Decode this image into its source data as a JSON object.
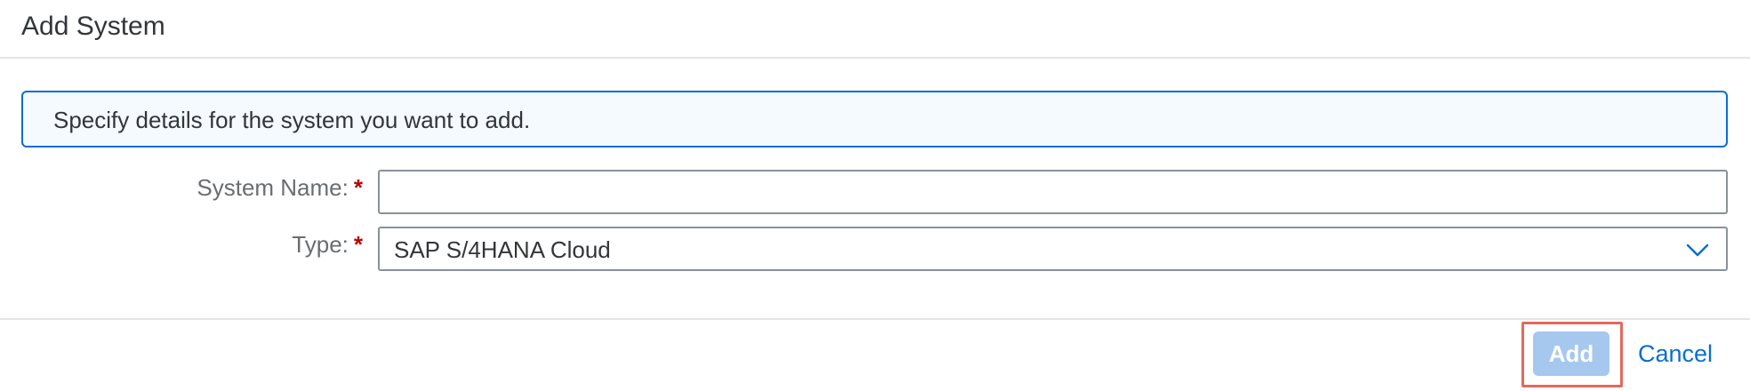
{
  "dialog": {
    "title": "Add System"
  },
  "info": {
    "text": "Specify details for the system you want to add."
  },
  "form": {
    "system_name": {
      "label": "System Name:",
      "required_marker": "*",
      "value": "",
      "placeholder": ""
    },
    "type": {
      "label": "Type:",
      "required_marker": "*",
      "value": "SAP S/4HANA Cloud"
    }
  },
  "footer": {
    "add_label": "Add",
    "cancel_label": "Cancel"
  },
  "icons": {
    "dropdown": "chevron-down-icon"
  },
  "colors": {
    "accent": "#0a6ed1",
    "required": "#bb0000",
    "add_button_disabled": "#a6c8ef",
    "highlight": "#e26a5e"
  }
}
